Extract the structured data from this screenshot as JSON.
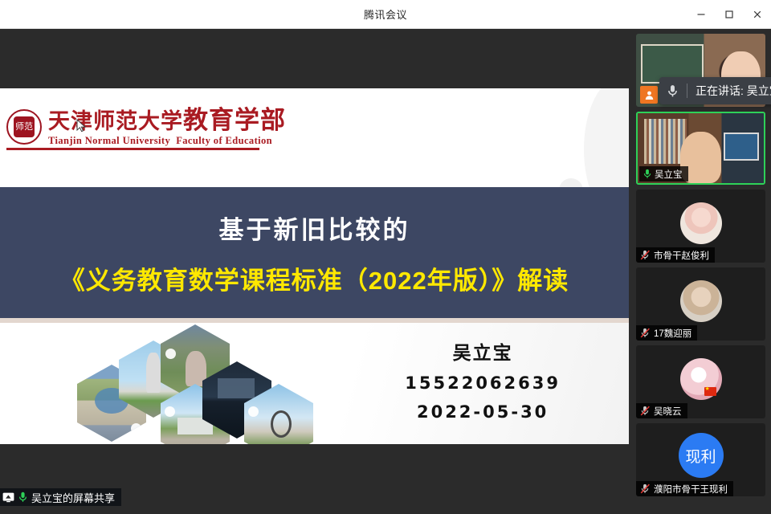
{
  "window": {
    "title": "腾讯会议",
    "controls": [
      {
        "name": "minimize",
        "glyph": "—"
      },
      {
        "name": "maximize",
        "glyph": "□"
      },
      {
        "name": "close",
        "glyph": "✕"
      }
    ]
  },
  "share": {
    "status_label": "吴立宝的屏幕共享",
    "screen_icon": "screen-share-icon",
    "mic_icon": "microphone-icon"
  },
  "toast": {
    "text": "正在讲话: 吴立宝",
    "icon": "microphone-icon"
  },
  "slide": {
    "logo": {
      "seal_text": "师范",
      "cn_name": "天津师范大学",
      "cn_dept": "教育学部",
      "en_name": "Tianjin Normal University",
      "en_dept": "Faculty of Education"
    },
    "title_line1": "基于新旧比较的",
    "title_line2": "《义务教育数学课程标准（2022年版）》解读",
    "presenter": {
      "name": "吴立宝",
      "phone": "15522062639",
      "date": "2022-05-30"
    },
    "colors": {
      "navy_band": "#3d4763",
      "title_yellow": "#ffe800",
      "logo_red": "#a91b22",
      "separator": "#e3d7cf"
    },
    "collage": {
      "name": "campus-hexagon-collage",
      "tiles": [
        {
          "name": "campus-plaza-photo"
        },
        {
          "name": "campus-tower-photo"
        },
        {
          "name": "campus-stone-monument-photo"
        },
        {
          "name": "campus-building-night-photo"
        },
        {
          "name": "campus-gate-photo"
        },
        {
          "name": "campus-sculpture-photo"
        }
      ]
    }
  },
  "participants": [
    {
      "name": "",
      "label": "",
      "video": true,
      "muted": false,
      "active_speaker": false,
      "host_badge": true,
      "avatar_kind": "webcam-woman"
    },
    {
      "name": "吴立宝",
      "label": "吴立宝",
      "video": true,
      "muted": false,
      "active_speaker": true,
      "host_badge": false,
      "avatar_kind": "webcam-man"
    },
    {
      "name": "市骨干赵俊利",
      "label": "市骨干赵俊利",
      "video": false,
      "muted": true,
      "active_speaker": false,
      "host_badge": false,
      "avatar_kind": "photo-baby"
    },
    {
      "name": "17魏迎丽",
      "label": "17魏迎丽",
      "video": false,
      "muted": true,
      "active_speaker": false,
      "host_badge": false,
      "avatar_kind": "photo-woman"
    },
    {
      "name": "吴晓云",
      "label": "吴晓云",
      "video": false,
      "muted": true,
      "active_speaker": false,
      "host_badge": false,
      "avatar_kind": "photo-pink"
    },
    {
      "name": "濮阳市骨干王现利",
      "label": "濮阳市骨干王现利",
      "video": false,
      "muted": true,
      "active_speaker": false,
      "host_badge": false,
      "avatar_kind": "initials",
      "initials": "现利"
    }
  ]
}
